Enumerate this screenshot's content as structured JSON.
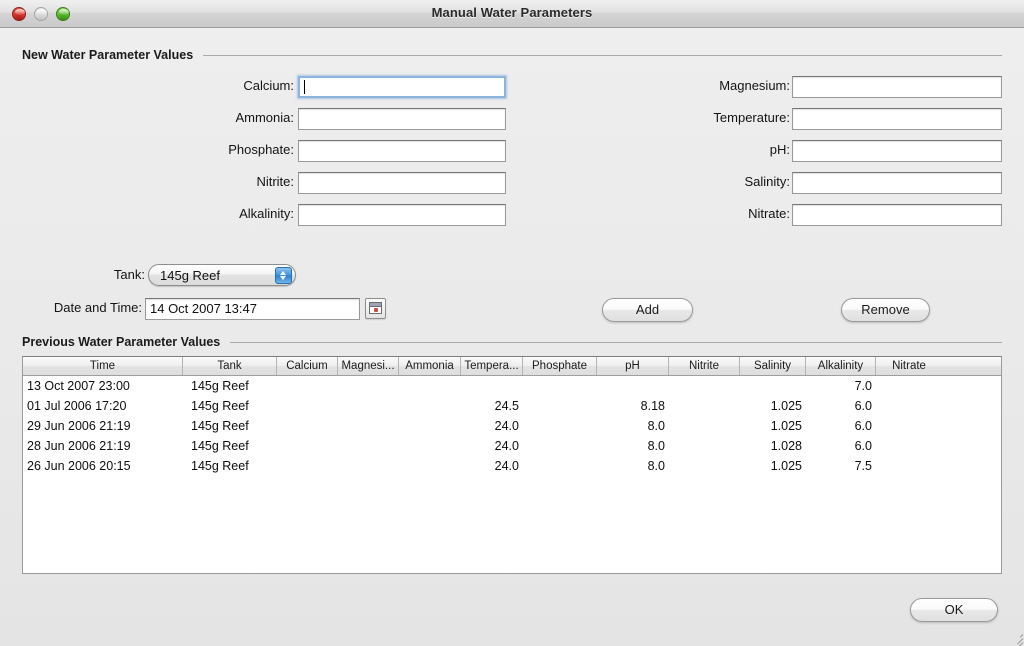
{
  "window": {
    "title": "Manual Water Parameters",
    "controls": {
      "close": "close-button",
      "minimize": "minimize-button",
      "zoom": "zoom-button"
    }
  },
  "new_values_group": {
    "title": "New Water Parameter Values",
    "left_fields": [
      {
        "label": "Calcium:",
        "value": "",
        "placeholder": "",
        "focused": true
      },
      {
        "label": "Ammonia:",
        "value": "",
        "placeholder": "",
        "focused": false
      },
      {
        "label": "Phosphate:",
        "value": "",
        "placeholder": "",
        "focused": false
      },
      {
        "label": "Nitrite:",
        "value": "",
        "placeholder": "",
        "focused": false
      },
      {
        "label": "Alkalinity:",
        "value": "",
        "placeholder": "",
        "focused": false
      }
    ],
    "right_fields": [
      {
        "label": "Magnesium:",
        "value": "",
        "placeholder": "",
        "focused": false
      },
      {
        "label": "Temperature:",
        "value": "",
        "placeholder": "",
        "focused": false
      },
      {
        "label": "pH:",
        "value": "",
        "placeholder": "",
        "focused": false
      },
      {
        "label": "Salinity:",
        "value": "",
        "placeholder": "",
        "focused": false
      },
      {
        "label": "Nitrate:",
        "value": "",
        "placeholder": "",
        "focused": false
      }
    ]
  },
  "tank_row": {
    "label": "Tank:",
    "selected": "145g Reef",
    "options": [
      "145g Reef"
    ]
  },
  "datetime_row": {
    "label": "Date and Time:",
    "value": "14 Oct 2007 13:47",
    "picker_icon": "calendar-icon"
  },
  "actions": {
    "add_label": "Add",
    "remove_label": "Remove",
    "ok_label": "OK"
  },
  "previous_group": {
    "title": "Previous Water Parameter Values"
  },
  "table": {
    "columns": [
      "Time",
      "Tank",
      "Calcium",
      "Magnesi...",
      "Ammonia",
      "Tempera...",
      "Phosphate",
      "pH",
      "Nitrite",
      "Salinity",
      "Alkalinity",
      "Nitrate"
    ],
    "rows": [
      {
        "Time": "13 Oct 2007 23:00",
        "Tank": "145g Reef",
        "Calcium": "",
        "Magnesium": "",
        "Ammonia": "",
        "Temperature": "",
        "Phosphate": "",
        "pH": "",
        "Nitrite": "",
        "Salinity": "",
        "Alkalinity": "7.0",
        "Nitrate": ""
      },
      {
        "Time": "01 Jul 2006 17:20",
        "Tank": "145g Reef",
        "Calcium": "",
        "Magnesium": "",
        "Ammonia": "",
        "Temperature": "24.5",
        "Phosphate": "",
        "pH": "8.18",
        "Nitrite": "",
        "Salinity": "1.025",
        "Alkalinity": "6.0",
        "Nitrate": ""
      },
      {
        "Time": "29 Jun 2006 21:19",
        "Tank": "145g Reef",
        "Calcium": "",
        "Magnesium": "",
        "Ammonia": "",
        "Temperature": "24.0",
        "Phosphate": "",
        "pH": "8.0",
        "Nitrite": "",
        "Salinity": "1.025",
        "Alkalinity": "6.0",
        "Nitrate": ""
      },
      {
        "Time": "28 Jun 2006 21:19",
        "Tank": "145g Reef",
        "Calcium": "",
        "Magnesium": "",
        "Ammonia": "",
        "Temperature": "24.0",
        "Phosphate": "",
        "pH": "8.0",
        "Nitrite": "",
        "Salinity": "1.028",
        "Alkalinity": "6.0",
        "Nitrate": ""
      },
      {
        "Time": "26 Jun 2006 20:15",
        "Tank": "145g Reef",
        "Calcium": "",
        "Magnesium": "",
        "Ammonia": "",
        "Temperature": "24.0",
        "Phosphate": "",
        "pH": "8.0",
        "Nitrite": "",
        "Salinity": "1.025",
        "Alkalinity": "7.5",
        "Nitrate": ""
      }
    ]
  },
  "colors": {
    "window_bg": "#e9e9e9",
    "focus_ring": "#8cb4de",
    "popup_accent": "#3f93dd",
    "close": "#d8322c",
    "zoom": "#56b72a"
  }
}
